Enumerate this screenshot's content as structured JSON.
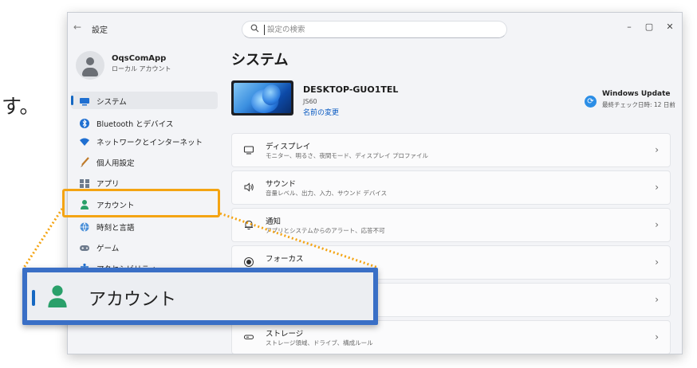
{
  "page_text": "す。",
  "window": {
    "title": "設定",
    "search_placeholder": "設定の検索",
    "controls": {
      "minimize": "–",
      "maximize": "▢",
      "close": "✕"
    }
  },
  "profile": {
    "name": "OqsComApp",
    "account_type": "ローカル アカウント"
  },
  "nav": [
    {
      "label": "システム",
      "icon": "monitor-icon",
      "selected": true
    },
    {
      "label": "Bluetooth とデバイス",
      "icon": "bluetooth-icon",
      "selected": false
    },
    {
      "label": "ネットワークとインターネット",
      "icon": "wifi-icon",
      "selected": false
    },
    {
      "label": "個人用設定",
      "icon": "brush-icon",
      "selected": false
    },
    {
      "label": "アプリ",
      "icon": "apps-icon",
      "selected": false
    },
    {
      "label": "アカウント",
      "icon": "person-icon",
      "selected": false
    },
    {
      "label": "時刻と言語",
      "icon": "globe-icon",
      "selected": false
    },
    {
      "label": "ゲーム",
      "icon": "gamepad-icon",
      "selected": false
    },
    {
      "label": "アクセシビリティ",
      "icon": "accessibility-icon",
      "selected": false
    }
  ],
  "main": {
    "title": "システム",
    "device": {
      "name": "DESKTOP-GUO1TEL",
      "model": "JS60",
      "rename_link": "名前の変更"
    },
    "windows_update": {
      "title": "Windows Update",
      "subtitle": "最終チェック日時: 12 日前"
    },
    "cards": [
      {
        "title": "ディスプレイ",
        "desc": "モニター、明るさ、夜間モード、ディスプレイ プロファイル",
        "icon": "display-icon"
      },
      {
        "title": "サウンド",
        "desc": "音量レベル、出力、入力、サウンド デバイス",
        "icon": "speaker-icon"
      },
      {
        "title": "通知",
        "desc": "アプリとシステムからのアラート、応答不可",
        "icon": "bell-icon"
      },
      {
        "title": "フォーカス",
        "desc": "",
        "icon": "focus-icon"
      },
      {
        "title": "",
        "desc": "",
        "icon": ""
      },
      {
        "title": "ストレージ",
        "desc": "ストレージ領域、ドライブ、構成ルール",
        "icon": "storage-icon"
      }
    ]
  },
  "callout": {
    "label": "アカウント"
  },
  "colors": {
    "accent": "#1668c2",
    "highlight": "#f4a413",
    "callout_border": "#3a6fc6"
  }
}
